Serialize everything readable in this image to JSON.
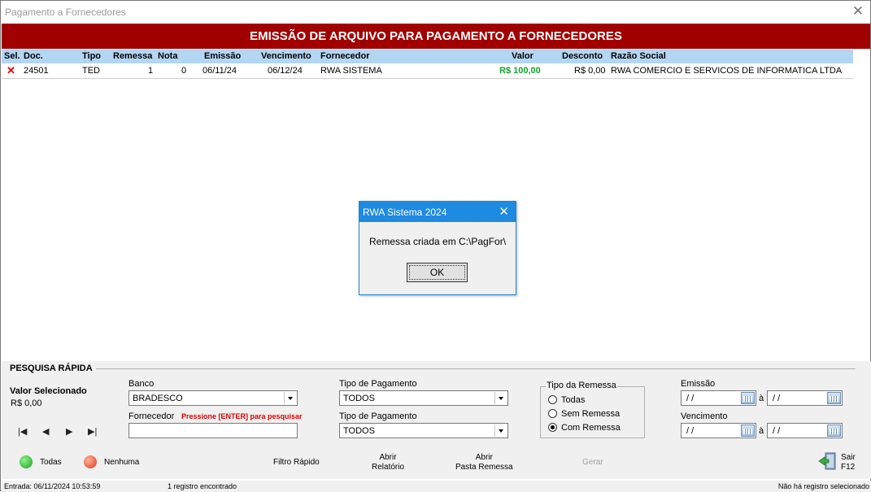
{
  "window": {
    "title": "Pagamento a Fornecedores",
    "close_glyph": "✕"
  },
  "banner": "EMISSÃO DE ARQUIVO PARA PAGAMENTO A FORNECEDORES",
  "grid": {
    "headers": {
      "sel": "Sel.",
      "doc": "Doc.",
      "tipo": "Tipo",
      "remessa": "Remessa",
      "nota": "Nota",
      "emissao": "Emissão",
      "vencimento": "Vencimento",
      "fornecedor": "Fornecedor",
      "valor": "Valor",
      "desconto": "Desconto",
      "razao": "Razão Social"
    },
    "rows": [
      {
        "sel": "✕",
        "doc": "24501",
        "tipo": "TED",
        "remessa": "1",
        "nota": "0",
        "emissao": "06/11/24",
        "vencimento": "06/12/24",
        "fornecedor": "RWA SISTEMA",
        "valor": "R$ 100,00",
        "desconto": "R$ 0,00",
        "razao": "RWA COMERCIO E SERVICOS DE INFORMATICA LTDA"
      }
    ]
  },
  "search": {
    "title": "PESQUISA RÁPIDA",
    "valor_label": "Valor Selecionado",
    "valor": "R$ 0,00",
    "banco_label": "Banco",
    "banco_value": "BRADESCO",
    "fornecedor_label": "Fornecedor",
    "fornecedor_hint": "Pressione [ENTER] para pesquisar",
    "fornecedor_value": "",
    "tipo_pag_label_1": "Tipo de Pagamento",
    "tipo_pag_value_1": "TODOS",
    "tipo_pag_label_2": "Tipo de Pagamento",
    "tipo_pag_value_2": "TODOS",
    "tipo_remessa_label": "Tipo da Remessa",
    "tipo_remessa_options": [
      "Todas",
      "Sem Remessa",
      "Com Remessa"
    ],
    "tipo_remessa_selected": "Com Remessa",
    "emissao_label": "Emissão",
    "emissao_from": "/ /",
    "emissao_to": "/ /",
    "vencimento_label": "Vencimento",
    "vencimento_from": "/ /",
    "vencimento_to": "/ /",
    "date_sep": "à",
    "nav": {
      "first": "|◀",
      "prev": "◀",
      "next": "▶",
      "last": "▶|"
    }
  },
  "actions": {
    "todas": "Todas",
    "nenhuma": "Nenhuma",
    "filtro": "Filtro Rápido",
    "abrir_relatorio_1": "Abrir",
    "abrir_relatorio_2": "Relatório",
    "abrir_pasta_1": "Abrir",
    "abrir_pasta_2": "Pasta Remessa",
    "gerar": "Gerar",
    "sair_1": "Sair",
    "sair_2": "F12"
  },
  "status": {
    "entrada": "Entrada: 06/11/2024 10:53:59",
    "registros": "1 registro encontrado",
    "selecao": "Não há registro selecionado"
  },
  "dialog": {
    "title": "RWA Sistema 2024",
    "message": "Remessa criada em C:\\PagFor\\",
    "ok": "OK",
    "close_glyph": "✕"
  },
  "colors": {
    "banner": "#a10000",
    "header": "#b3d6f2",
    "accent": "#1e8ae0",
    "value_green": "#14a32b"
  }
}
